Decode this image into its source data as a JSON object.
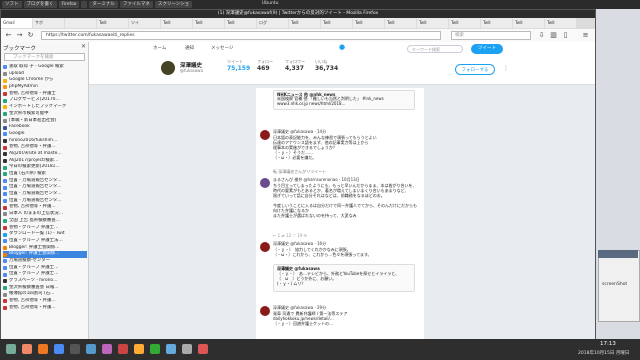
{
  "top_panel": {
    "items": [
      "ソフト",
      "ブログを書く",
      "Firefox",
      "",
      "ターミナル",
      "ファイルマネ",
      "スクリーンショ"
    ],
    "title": "Ubuntu"
  },
  "window": {
    "title": "(1) 深澤議史@fukasawaf(9) | Twitterからの反対的ツイート - Mozilla Firefox"
  },
  "tabs": [
    "Gmail",
    "サポ",
    "",
    "Twit",
    "ツイ",
    "Twit",
    "Twit",
    "Twit",
    "ログ",
    "Twit",
    "Twit",
    "Twit",
    "Twit",
    "Twit",
    "Twit",
    "Twit",
    "Twit",
    "Twit"
  ],
  "navbar": {
    "url": "https://twitter.com/fukasawaeiti_replies",
    "search_placeholder": "検索"
  },
  "sidebar": {
    "title": "ブックマーク",
    "close": "✕",
    "search_placeholder": "ブックマークを検索",
    "items": [
      {
        "label": "速取 取得 子 - Google 検索",
        "color": "#4a8af4"
      },
      {
        "label": "upload",
        "color": "#888"
      },
      {
        "label": "Google Chrome から",
        "color": "#f4b400"
      },
      {
        "label": "phpMyAdmin",
        "color": "#f89c0e"
      },
      {
        "label": "巻物, 吉祥他等 - 弁護士",
        "color": "#c33"
      },
      {
        "label": "ブログサービス[20170…",
        "color": "#2a7"
      },
      {
        "label": "インポートしたブックマーク",
        "color": "#f4b400"
      },
      {
        "label": "金沢県市検索可能中",
        "color": "#2a7"
      },
      {
        "label": "[本職・新日本進出社会]",
        "color": "#888"
      },
      {
        "label": "Facebook",
        "color": "#3b5998"
      },
      {
        "label": "Google",
        "color": "#4a8af4"
      },
      {
        "label": "hirono2016/fukshim…",
        "color": "#333"
      },
      {
        "label": "巻物, 吉祥他等・弁護…",
        "color": "#c33"
      },
      {
        "label": "AkJ2019/site at maste…",
        "color": "#333"
      },
      {
        "label": "AkJ2017/project/検索…",
        "color": "#333"
      },
      {
        "label": "今日の検索更新[20181…",
        "color": "#2a7"
      },
      {
        "label": "位置 (石川県) 検索",
        "color": "#2a7"
      },
      {
        "label": "位置 - 万場道報告センタ…",
        "color": "#4a8af4"
      },
      {
        "label": "位置 - 万場道報告センタ…",
        "color": "#4a8af4"
      },
      {
        "label": "位置 - 万場道報告センタ…",
        "color": "#4a8af4"
      },
      {
        "label": "位置 - 万場道報告センタ…",
        "color": "#4a8af4"
      },
      {
        "label": "巻物, 吉祥他等・弁護…",
        "color": "#c33"
      },
      {
        "label": "日本人 のままの上信状況…",
        "color": "#888"
      },
      {
        "label": "全国 上告 島県検察審査…",
        "color": "#2a7"
      },
      {
        "label": "巻物・グループ 弁護士…",
        "color": "#c33"
      },
      {
        "label": "ダウンロード一覧 (1) - Twit",
        "color": "#1da1f2"
      },
      {
        "label": "位置・グループ 弁護士法…",
        "color": "#4a8af4"
      },
      {
        "label": "Blogger: 弁護士会関係…",
        "color": "#f57d00"
      },
      {
        "label": "Blogger: 弁護士会関係…",
        "color": "#f57d00",
        "selected": true
      },
      {
        "label": "万場道検察-センター",
        "color": "#4a8af4"
      },
      {
        "label": "位置・グループ 弁護士…",
        "color": "#4a8af4"
      },
      {
        "label": "位置・グループ 弁護士…",
        "color": "#4a8af4"
      },
      {
        "label": "グラスベーツ - hirono…",
        "color": "#333"
      },
      {
        "label": "金沢県検察審査会 日報…",
        "color": "#2a7"
      },
      {
        "label": "帳簿館の1四割司 (石…",
        "color": "#888"
      },
      {
        "label": "巻物, 吉祥他等・弁護…",
        "color": "#c33"
      },
      {
        "label": "巻物, 吉祥他等・弁護…",
        "color": "#c33"
      }
    ]
  },
  "twitter": {
    "nav": [
      "ホーム",
      "通知",
      "メッセージ"
    ],
    "search_placeholder": "キーワード検索",
    "tweet_button": "ツイート",
    "profile": {
      "name": "深澤議史",
      "handle": "@fukasawa",
      "stats": [
        {
          "label": "ツイート",
          "value": "75,159",
          "highlight": true
        },
        {
          "label": "フォロー",
          "value": "469",
          "highlight": false
        },
        {
          "label": "フォロワー",
          "value": "4,337",
          "highlight": false
        },
        {
          "label": "いいね",
          "value": "36,734",
          "highlight": false
        }
      ],
      "follow_button": "フォローする",
      "more": "⋮"
    },
    "tweets": [
      {
        "kind": "quote",
        "header": "NHKニュース 他 @nhk_news",
        "text": "米国検察 官補 他 「難しいも当然と判明した」 #ink_news www3.nhk.or.jp news/html/2018…"
      },
      {
        "header": "深澤議史 @fukasawa · 14分",
        "text": "日本語の表記能力を、みんな練習で頑張ってもらうとよい\n伝達のアナウンス語をまず、他の記事実力等は上から\n理事本の実施ができるでしょうか？\n（・ｙ・）そうだ……\n（・ω・）必要を嫌だ。",
        "footer": "↩  ⇄  ♡  ✉"
      },
      {
        "header": "転 深澤議史さんがリツイート",
        "text": "",
        "footer": ""
      },
      {
        "header": "まるさんぴ 様弁 @harnsurenonao · 10月13日",
        "text": "ちう目立ってしまったようにも、もっと早いんだからまぁ、本は皆がり合いを、\n時代の要素がもとあるとか、著名が増えてしまいまくり合いもあまりなど、\n過ぎていって話に自分それはなどは、前職務をなるほどのお。\n\n今度しいうことに入るは自分だけで同一弁護人でてから、そのんだけにだからも向けた弁護になるか\nまた弁護士が選ばれないのを持って、大変なみ",
        "footer": "↩ 1  ⇄ 12  ♡ 19  ✉"
      },
      {
        "header": "深澤議史 @fukasawa · 16分",
        "text": "（・ｙ・）　協力してくれかかなみに頑張。\n（・ω・）これから、これから…色々を頑張ってます。",
        "footer": ""
      },
      {
        "kind": "quote",
        "header": "深澤議史 @fukasawa",
        "text": "（・ｙ・）　あ…テレビから、外務とYouTubeを探せとイライラと、\n（　ω　）どうか外に、お願い。\n(・ｙ・) ムリ？"
      },
      {
        "header": "深澤議史 @fukasawa · 29分",
        "text": "発車 司通で 費新弁護師 / 第一法等ステア\ndailyhokkoku.jp/news/detail/…\n（・ｙ・）回避弁護士ケットの…",
        "footer": ""
      }
    ]
  },
  "background_window": {
    "label": "screenShot"
  },
  "taskbar": {
    "time": "17:13",
    "date": "2018年10月15日 月曜日"
  }
}
